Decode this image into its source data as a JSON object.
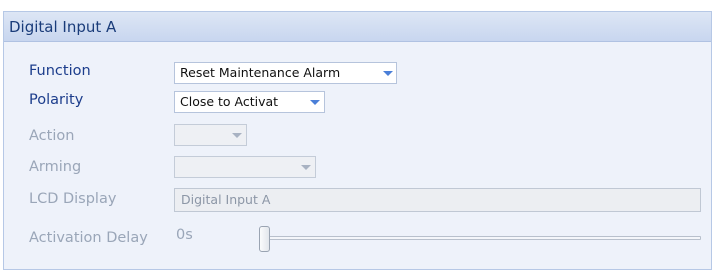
{
  "panel": {
    "title": "Digital Input A"
  },
  "fields": {
    "function": {
      "label": "Function",
      "value": "Reset Maintenance Alarm",
      "icon": "chevron-down-icon"
    },
    "polarity": {
      "label": "Polarity",
      "value": "Close to Activat",
      "icon": "chevron-down-icon"
    },
    "action": {
      "label": "Action",
      "value": "",
      "icon": "chevron-down-icon"
    },
    "arming": {
      "label": "Arming",
      "value": "",
      "icon": "chevron-down-icon"
    },
    "lcd_display": {
      "label": "LCD Display",
      "value": "Digital Input A"
    },
    "activation_delay": {
      "label": "Activation Delay",
      "value": "0s",
      "slider_fraction": 0
    }
  },
  "colors": {
    "label_enabled": "#1c3d8c",
    "label_disabled": "#9aa6b8",
    "accent_arrow": "#4a7fd8",
    "header_text": "#1a3c7a"
  }
}
